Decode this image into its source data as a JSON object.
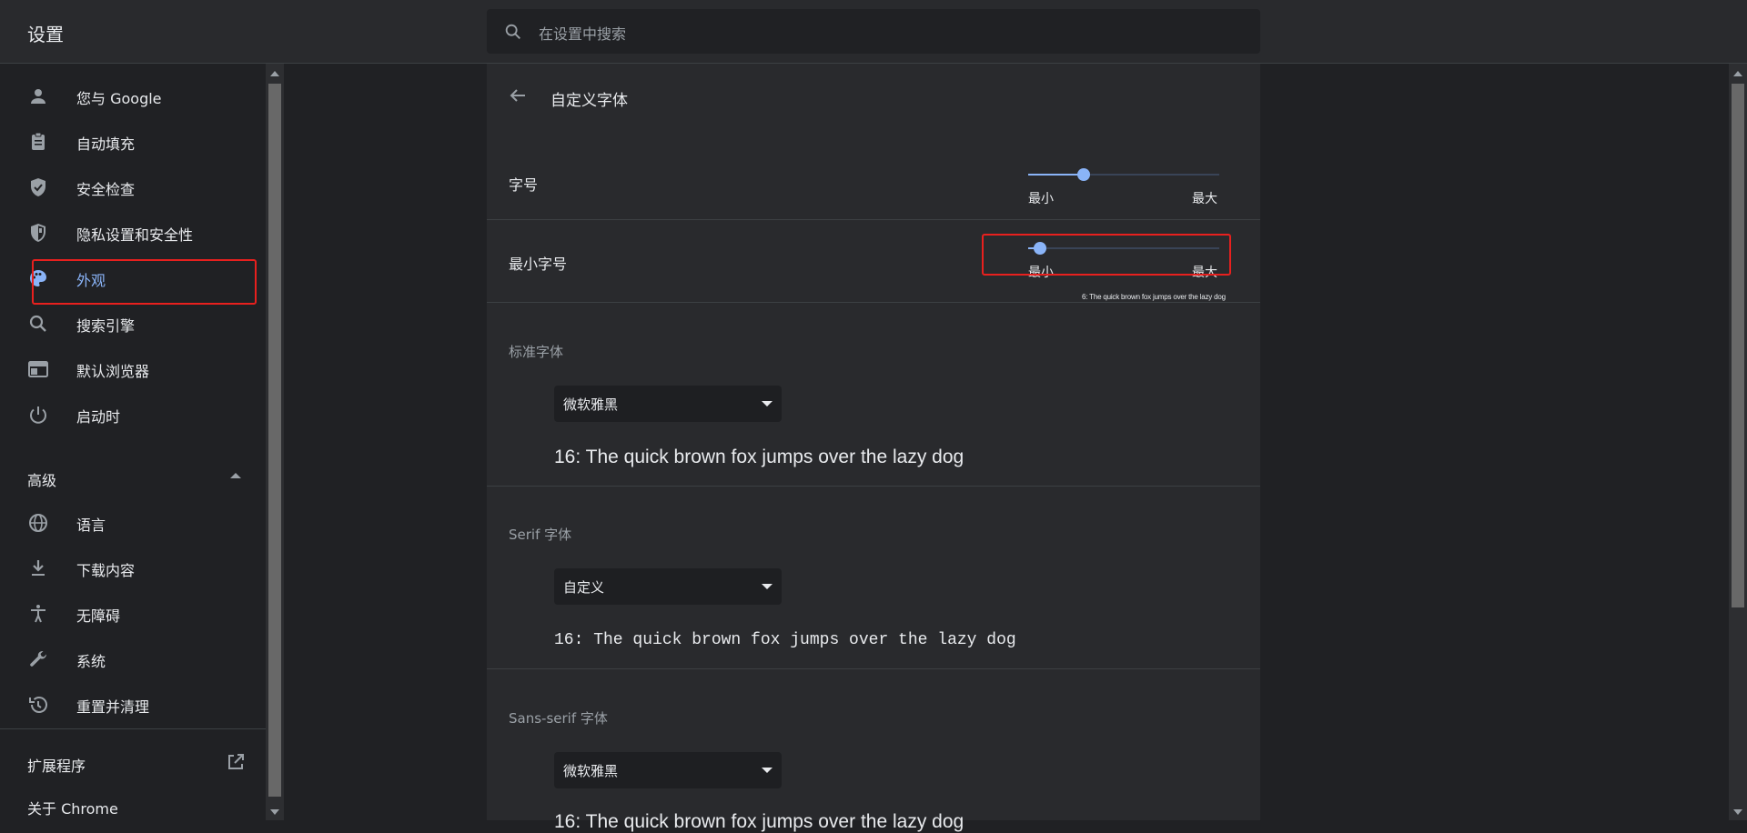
{
  "header": {
    "title": "设置",
    "search_placeholder": "在设置中搜索"
  },
  "sidebar": {
    "items": [
      {
        "label": "您与 Google",
        "icon": "person-icon"
      },
      {
        "label": "自动填充",
        "icon": "clipboard-icon"
      },
      {
        "label": "安全检查",
        "icon": "shield-check-icon"
      },
      {
        "label": "隐私设置和安全性",
        "icon": "shield-half-icon"
      },
      {
        "label": "外观",
        "icon": "palette-icon",
        "active": true
      },
      {
        "label": "搜索引擎",
        "icon": "search-icon"
      },
      {
        "label": "默认浏览器",
        "icon": "browser-icon"
      },
      {
        "label": "启动时",
        "icon": "power-icon"
      }
    ],
    "advanced": {
      "label": "高级",
      "items": [
        {
          "label": "语言",
          "icon": "globe-icon"
        },
        {
          "label": "下载内容",
          "icon": "download-icon"
        },
        {
          "label": "无障碍",
          "icon": "accessibility-icon"
        },
        {
          "label": "系统",
          "icon": "wrench-icon"
        },
        {
          "label": "重置并清理",
          "icon": "history-icon"
        }
      ]
    },
    "extensions": {
      "label": "扩展程序",
      "icon": "external-link-icon"
    },
    "about": {
      "label": "关于 Chrome"
    }
  },
  "page": {
    "title": "自定义字体",
    "font_size": {
      "label": "字号",
      "min_label": "最小",
      "max_label": "最大",
      "level": 0.29
    },
    "min_font_size": {
      "label": "最小字号",
      "min_label": "最小",
      "max_label": "最大",
      "level": 0.06,
      "sample": "6: The quick brown fox jumps over the lazy dog"
    },
    "standard_font": {
      "label": "标准字体",
      "value": "微软雅黑",
      "sample": "16: The quick brown fox jumps over the lazy dog"
    },
    "serif_font": {
      "label": "Serif 字体",
      "value": "自定义",
      "sample": "16: The quick brown fox jumps over the lazy dog"
    },
    "sans_serif_font": {
      "label": "Sans-serif 字体",
      "value": "微软雅黑",
      "sample": "16: The quick brown fox jumps over the lazy dog"
    }
  },
  "colors": {
    "accent": "#8ab4f8",
    "highlight_box": "#e8201e",
    "background": "#202124",
    "card": "#292a2d"
  }
}
